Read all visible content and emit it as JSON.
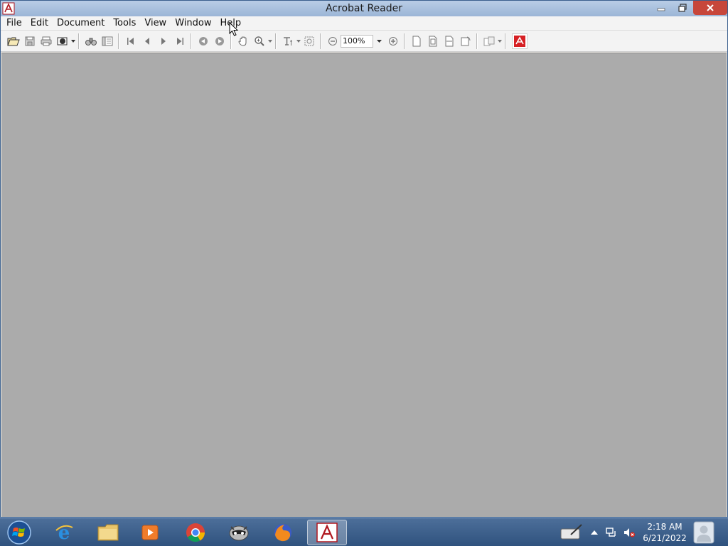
{
  "window": {
    "title": "Acrobat Reader"
  },
  "menu": {
    "items": [
      "File",
      "Edit",
      "Document",
      "Tools",
      "View",
      "Window",
      "Help"
    ]
  },
  "toolbar": {
    "zoom_value": "100%"
  },
  "taskbar": {
    "clock_time": "2:18 AM",
    "clock_date": "6/21/2022"
  },
  "colors": {
    "workspace": "#ababab",
    "titlebar": "#9bb5d6",
    "close_button": "#c7463a",
    "taskbar": "#2f527e"
  }
}
